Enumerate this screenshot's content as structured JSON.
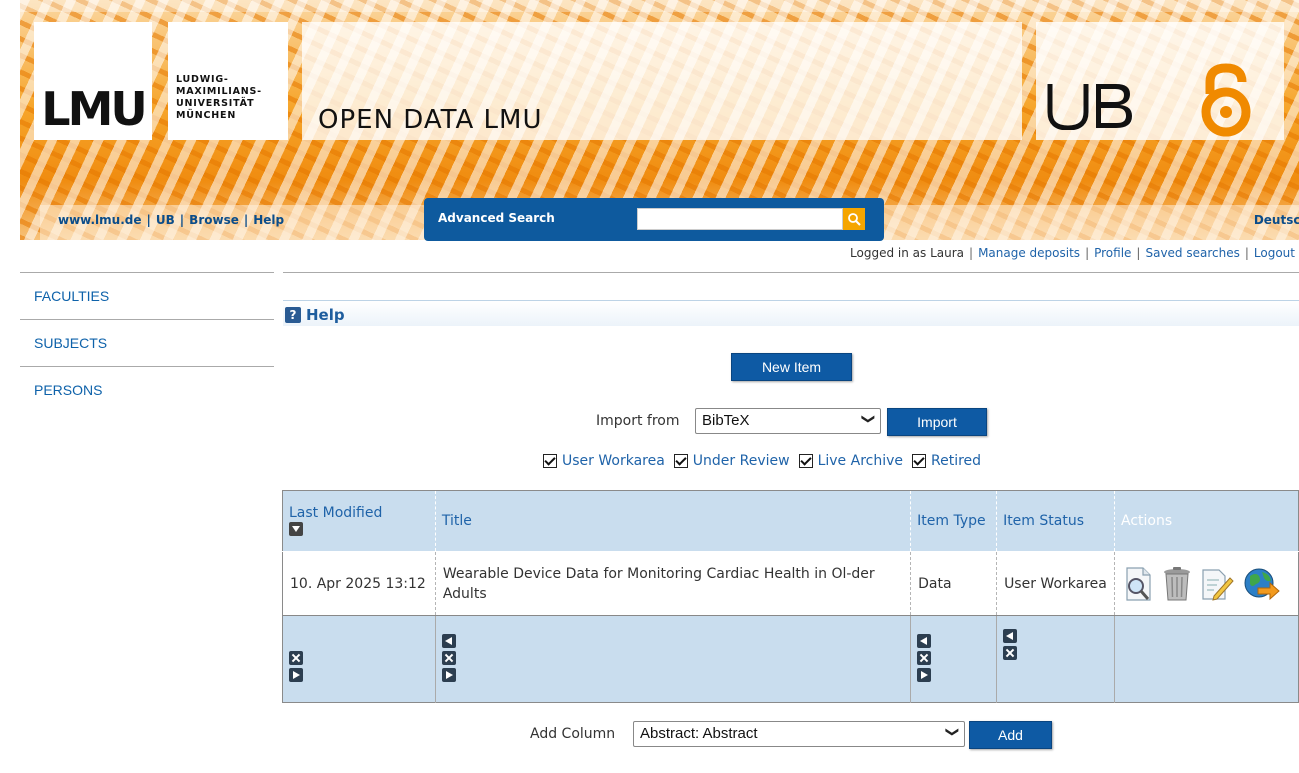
{
  "header": {
    "lmu_wordmark": "LMU",
    "university_lines": [
      "LUDWIG-",
      "MAXIMILIANS-",
      "UNIVERSITÄT",
      "MÜNCHEN"
    ],
    "site_title": "OPEN DATA LMU",
    "ub_logo": "UB"
  },
  "nav": {
    "links": [
      "www.lmu.de",
      "UB",
      "Browse",
      "Help"
    ],
    "advanced_search": "Advanced Search",
    "search_value": "",
    "language": "Deutsch"
  },
  "userbar": {
    "logged_in_as": "Logged in as Laura",
    "links": [
      "Manage deposits",
      "Profile",
      "Saved searches",
      "Logout"
    ]
  },
  "sidebar": {
    "items": [
      "FACULTIES",
      "SUBJECTS",
      "PERSONS"
    ]
  },
  "help": {
    "label": "Help",
    "icon": "help-icon"
  },
  "actions": {
    "new_item": "New Item",
    "import_from": "Import from",
    "import_format": "BibTeX",
    "import_button": "Import"
  },
  "filters": [
    "User Workarea",
    "Under Review",
    "Live Archive",
    "Retired"
  ],
  "table": {
    "headers": [
      "Last Modified",
      "Title",
      "Item Type",
      "Item Status",
      "Actions"
    ],
    "rows": [
      {
        "last_modified": "10. Apr 2025 13:12",
        "title": "Wearable Device Data for Monitoring Cardiac Health in Ol-der Adults",
        "item_type": "Data",
        "item_status": "User Workarea",
        "action_icons": [
          "view-icon",
          "delete-icon",
          "edit-icon",
          "deposit-icon"
        ]
      }
    ]
  },
  "add_column": {
    "label": "Add Column",
    "selected": "Abstract: Abstract",
    "button": "Add"
  },
  "colors": {
    "banner_orange": "#f7a21b",
    "brand_blue": "#0e5aa4",
    "link_blue": "#1f63a9",
    "table_header_bg": "#c9ddee"
  }
}
